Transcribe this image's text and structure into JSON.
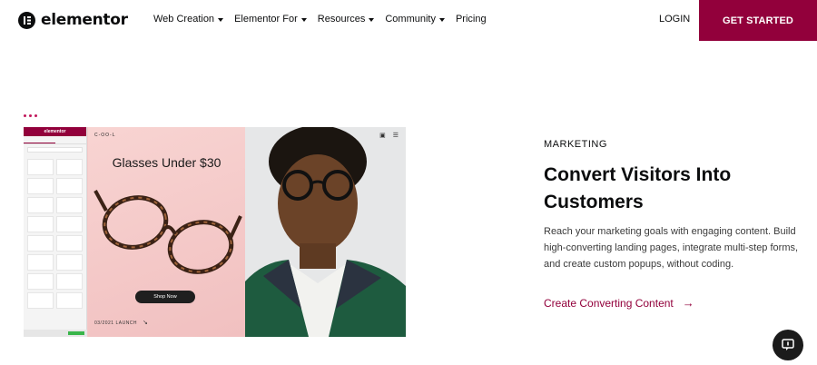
{
  "nav": {
    "logo_text": "elementor",
    "menu": [
      {
        "label": "Web Creation",
        "has_dropdown": true
      },
      {
        "label": "Elementor For",
        "has_dropdown": true
      },
      {
        "label": "Resources",
        "has_dropdown": true
      },
      {
        "label": "Community",
        "has_dropdown": true
      },
      {
        "label": "Pricing",
        "has_dropdown": false
      }
    ],
    "login_label": "LOGIN",
    "cta_label": "GET STARTED"
  },
  "hero_image": {
    "editor_title": "elementor",
    "brand": "C-OO-L",
    "promo_title": "Glasses Under $30",
    "shop_button": "Shop Now",
    "launch_text": "03/2021 LAUNCH",
    "launch_arrow": "↘"
  },
  "feature": {
    "eyebrow": "MARKETING",
    "headline": "Convert Visitors Into Customers",
    "body": "Reach your marketing goals with engaging content. Build high-converting landing pages, integrate multi-step forms, and create custom popups, without coding.",
    "link_label": "Create Converting Content",
    "link_arrow": "→"
  },
  "colors": {
    "brand": "#92003b",
    "text": "#0c0d0e",
    "hero_pink": "#f3c8c8"
  },
  "icons": [
    "elementor-logo-icon",
    "dropdown-caret-icon",
    "arrow-right-icon",
    "chat-icon",
    "bag-icon",
    "hamburger-icon"
  ]
}
